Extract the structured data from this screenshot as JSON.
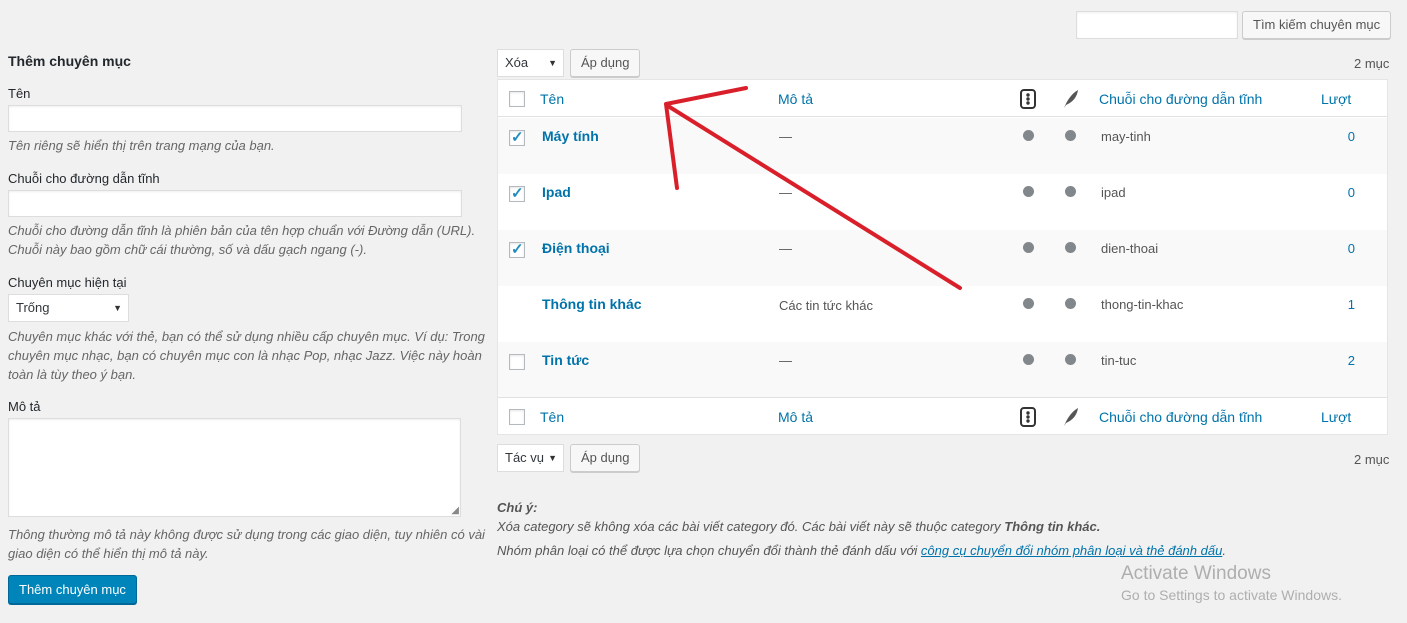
{
  "search": {
    "placeholder": "",
    "button": "Tìm kiếm chuyên mục"
  },
  "add_form": {
    "heading": "Thêm chuyên mục",
    "name_label": "Tên",
    "name_help": "Tên riêng sẽ hiển thị trên trang mạng của bạn.",
    "slug_label": "Chuỗi cho đường dẫn tĩnh",
    "slug_help_1": "Chuỗi cho đường dẫn tĩnh là phiên bản của tên hợp chuẩn với Đường dẫn (URL).",
    "slug_help_2": "Chuỗi này bao gồm chữ cái thường, số và dấu gạch ngang (-).",
    "parent_label": "Chuyên mục hiện tại",
    "parent_value": "Trống",
    "parent_help_1": "Chuyên mục khác với thẻ, bạn có thể sử dụng nhiều cấp chuyên mục. Ví dụ: Trong",
    "parent_help_2": "chuyên mục nhạc, bạn có chuyên mục con là nhạc Pop, nhạc Jazz. Việc này hoàn",
    "parent_help_3": "toàn là tùy theo ý bạn.",
    "desc_label": "Mô tả",
    "desc_help_1": "Thông thường mô tả này không được sử dụng trong các giao diện, tuy nhiên có vài",
    "desc_help_2": "giao diện có thể hiển thị mô tả này.",
    "submit": "Thêm chuyên mục"
  },
  "bulk_top": {
    "action": "Xóa",
    "apply": "Áp dụng",
    "count": "2 mục"
  },
  "bulk_bottom": {
    "action": "Tác vụ",
    "apply": "Áp dụng",
    "count": "2 mục"
  },
  "columns": {
    "name": "Tên",
    "description": "Mô tả",
    "slug": "Chuỗi cho đường dẫn tĩnh",
    "count": "Lượt"
  },
  "rows": [
    {
      "name": "Máy tính",
      "description": "—",
      "slug": "may-tinh",
      "count": "0",
      "checked": true
    },
    {
      "name": "Ipad",
      "description": "—",
      "slug": "ipad",
      "count": "0",
      "checked": true
    },
    {
      "name": "Điện thoại",
      "description": "—",
      "slug": "dien-thoai",
      "count": "0",
      "checked": true
    },
    {
      "name": "Thông tin khác",
      "description": "Các tin tức khác",
      "slug": "thong-tin-khac",
      "count": "1",
      "checked": false
    },
    {
      "name": "Tin tức",
      "description": "—",
      "slug": "tin-tuc",
      "count": "2",
      "checked": false
    }
  ],
  "note": {
    "title": "Chú ý:",
    "line1_prefix": "Xóa category sẽ không xóa các bài viết category đó. Các bài viết này sẽ thuộc category ",
    "line1_bold": "Thông tin khác.",
    "line2_prefix": "Nhóm phân loại có thể được lựa chọn chuyển đổi thành thẻ đánh dấu với ",
    "line2_link": "công cụ chuyển đổi nhóm phân loại và thẻ đánh dấu",
    "line2_suffix": "."
  },
  "watermark": {
    "title": "Activate Windows",
    "subtitle": "Go to Settings to activate Windows."
  },
  "colors": {
    "link": "#0073aa",
    "primary_button": "#0085ba",
    "annotation_arrow": "#d9202a"
  }
}
